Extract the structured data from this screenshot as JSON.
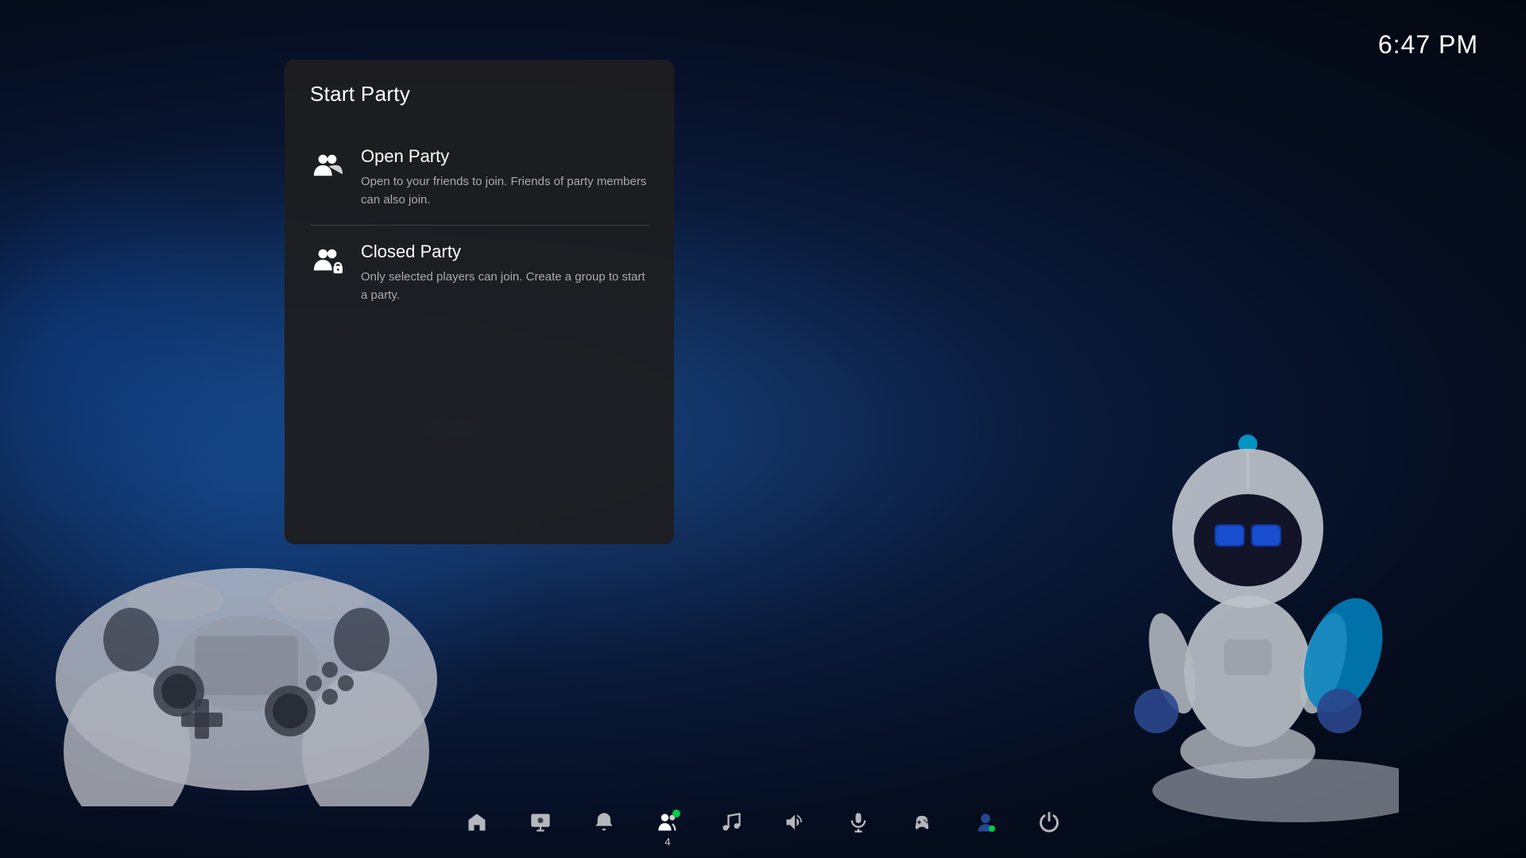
{
  "time": "6:47 PM",
  "panel": {
    "title": "Start Party",
    "options": [
      {
        "id": "open-party",
        "title": "Open Party",
        "description": "Open to your friends to join. Friends of party members can also join.",
        "icon": "open-party-icon"
      },
      {
        "id": "closed-party",
        "title": "Closed Party",
        "description": "Only selected players can join. Create a group to start a party.",
        "icon": "closed-party-icon"
      }
    ]
  },
  "taskbar": {
    "items": [
      {
        "id": "home",
        "icon": "home-icon",
        "label": ""
      },
      {
        "id": "media",
        "icon": "media-icon",
        "label": ""
      },
      {
        "id": "notifications",
        "icon": "bell-icon",
        "label": ""
      },
      {
        "id": "friends",
        "icon": "friends-icon",
        "label": "",
        "badge_count": "4",
        "badge_dot": true,
        "active": true
      },
      {
        "id": "music",
        "icon": "music-icon",
        "label": ""
      },
      {
        "id": "volume",
        "icon": "volume-icon",
        "label": ""
      },
      {
        "id": "mic",
        "icon": "mic-icon",
        "label": ""
      },
      {
        "id": "controller",
        "icon": "controller-icon",
        "label": ""
      },
      {
        "id": "profile",
        "icon": "profile-icon",
        "label": ""
      },
      {
        "id": "power",
        "icon": "power-icon",
        "label": ""
      }
    ]
  },
  "colors": {
    "accent": "#00cc44",
    "panel_bg": "rgba(30,30,32,0.95)",
    "text_primary": "#ffffff",
    "text_secondary": "#aaaaaa"
  }
}
